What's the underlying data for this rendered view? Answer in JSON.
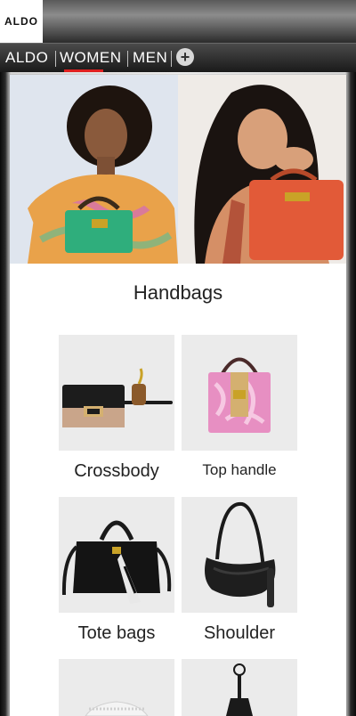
{
  "header": {
    "logo_text": "ALDO"
  },
  "nav": {
    "items": [
      {
        "label": "ALDO"
      },
      {
        "label": "WOMEN",
        "active": true
      },
      {
        "label": "MEN"
      }
    ],
    "add_icon": "plus-circle-icon",
    "accent_color": "#e02020"
  },
  "main": {
    "section_title": "Handbags",
    "categories": [
      {
        "label": "Crossbody"
      },
      {
        "label": "Top handle"
      },
      {
        "label": "Tote bags"
      },
      {
        "label": "Shoulder"
      }
    ]
  }
}
